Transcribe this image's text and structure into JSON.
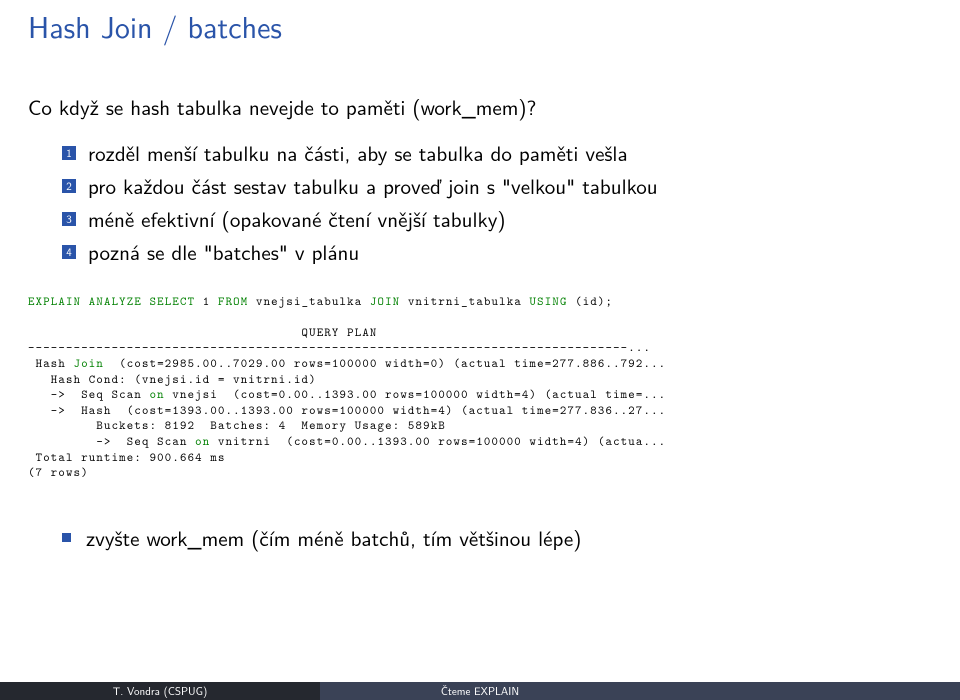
{
  "title": "Hash Join / batches",
  "intro": "Co když se hash tabulka nevejde to paměti (work_mem)?",
  "enum": [
    "rozděl menší tabulku na části, aby se tabulka do paměti vešla",
    "pro každou část sestav tabulku a proveď join s \"velkou\" tabulkou",
    "méně efektivní (opakované čtení vnější tabulky)",
    "pozná se dle \"batches\" v plánu"
  ],
  "code": {
    "explain_pre": "EXPLAIN ANALYZE SELECT",
    "explain_mid": " 1 ",
    "explain_from": "FROM",
    "explain_t1": " vnejsi_tabulka ",
    "explain_join": "JOIN",
    "explain_t2": " vnitrni_tabulka ",
    "explain_using": "USING",
    "explain_end": " (id);",
    "qp_label": "                                    QUERY PLAN",
    "sep": "-------------------------------------------------------------------------------...",
    "l1a": " Hash ",
    "l1_join": "Join",
    "l1b": "  (cost=2985.00..7029.00 rows=100000 width=0) (actual time=277.886..792...",
    "l2": "   Hash Cond: (vnejsi.id = vnitrni.id)",
    "l3a": "   ->  Seq Scan ",
    "l3_on": "on",
    "l3b": " vnejsi  (cost=0.00..1393.00 rows=100000 width=4) (actual time=...",
    "l4": "   ->  Hash  (cost=1393.00..1393.00 rows=100000 width=4) (actual time=277.836..27...",
    "l5": "         Buckets: 8192  Batches: 4  Memory Usage: 589kB",
    "l6a": "         ->  Seq Scan ",
    "l6_on": "on",
    "l6b": " vnitrni  (cost=0.00..1393.00 rows=100000 width=4) (actua...",
    "l7": " Total runtime: 900.664 ms",
    "l8": "(7 rows)"
  },
  "bullet": "zvyšte work_mem (čím méně batchů, tím většinou lépe)",
  "footer": {
    "left": "T. Vondra (CSPUG)",
    "mid": "Čteme EXPLAIN",
    "right": ""
  }
}
